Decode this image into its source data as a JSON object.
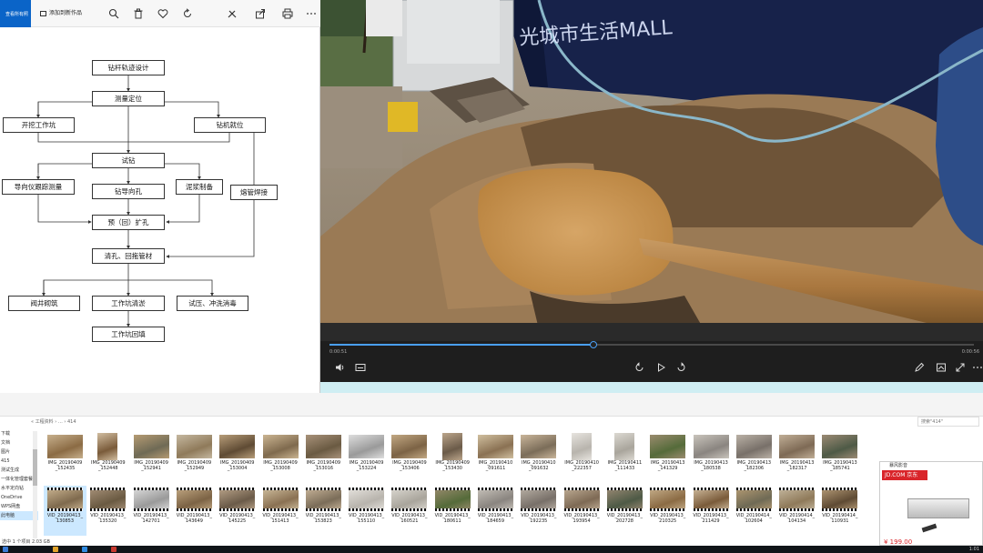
{
  "photo_viewer": {
    "tab_active": "查看所有照片",
    "tab_add": "添加到新作品",
    "icons": [
      "zoom-icon",
      "delete-icon",
      "favorite-icon",
      "rotate-icon",
      "edit-icon",
      "share-icon",
      "print-icon",
      "more-icon"
    ]
  },
  "flowchart": {
    "nodes": {
      "design": "钻杆轨迹设计",
      "survey": "测量定位",
      "pit": "开挖工作坑",
      "rig": "钻机就位",
      "trial": "试钻",
      "guide": "导向仪跟踪测量",
      "pilot": "钻导向孔",
      "mud": "泥浆制备",
      "weld": "熔管焊接",
      "ream": "预（回）扩孔",
      "pull": "清孔、回拖管材",
      "well": "阀井砌筑",
      "cleanup": "工作坑清淤",
      "test": "试压、冲洗消毒",
      "backfill": "工作坑回填"
    }
  },
  "video_player": {
    "sign_text": "光城市生活MALL",
    "time_elapsed": "0:00:51",
    "time_total": "0:00:56",
    "progress": 0.41,
    "accent": "#4a9ff5",
    "controls": [
      "volume-icon",
      "subtitles-icon",
      "rewind-icon",
      "play-icon",
      "forward-icon",
      "edit-icon",
      "crop-icon",
      "fullscreen-icon",
      "more-icon"
    ]
  },
  "explorer": {
    "search_placeholder": "搜索\"414\"",
    "address": "« 工程资料 › … › 414",
    "sidebar": [
      "下载",
      "文档",
      "图片",
      "415",
      "测试生成",
      "一体化管理套餐",
      "水平定向钻",
      "OneDrive",
      "WPS网盘",
      "此电脑"
    ],
    "files_row1": [
      "IMG_20190409\n_152435",
      "IMG_20190409\n_152448",
      "IMG_20190409\n_152941",
      "IMG_20190409\n_152949",
      "IMG_20190409\n_153004",
      "IMG_20190409\n_153008",
      "IMG_20190409\n_153016",
      "IMG_20190409\n_153224",
      "IMG_20190409\n_153406",
      "IMG_20190409\n_153430",
      "IMG_20190410\n_091611",
      "IMG_20190410\n_091632",
      "IMG_20190410\n_222357",
      "IMG_20190411\n_111433",
      "IMG_20190413\n_141329",
      "IMG_20190413\n_180538",
      "IMG_20190413\n_182306",
      "IMG_20190413\n_182317",
      "IMG_20190413\n_185741"
    ],
    "files_row2": [
      "VID_20190413_\n130853",
      "VID_20190413_\n135320",
      "VID_20190413_\n142701",
      "VID_20190413_\n143649",
      "VID_20190413_\n145225",
      "VID_20190413_\n151413",
      "VID_20190413_\n153823",
      "VID_20190413_\n155110",
      "VID_20190413_\n160521",
      "VID_20190413_\n180611",
      "VID_20190413_\n184659",
      "VID_20190413_\n192235",
      "VID_20190413_\n193954",
      "VID_20190413_\n202728",
      "VID_20190413_\n210325",
      "VID_20190413_\n211429",
      "VID_20190414_\n102604",
      "VID_20190414_\n104134",
      "VID_20190414_\n110931"
    ],
    "status": "选中 1 个项目  2.03 GB"
  },
  "ad": {
    "header": "暴风影音",
    "logo": "JD.COM 京东",
    "price": "¥ 199.00"
  },
  "taskbar": {
    "time": "1:01"
  }
}
